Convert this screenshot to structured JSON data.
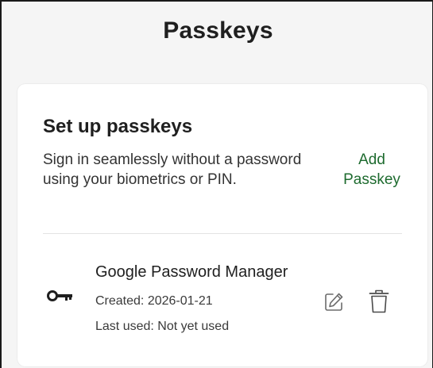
{
  "header": {
    "title": "Passkeys"
  },
  "setup": {
    "title": "Set up passkeys",
    "description": "Sign in seamlessly without a password using your biometrics or PIN.",
    "add_label": "Add Passkey"
  },
  "passkeys": [
    {
      "name": "Google Password Manager",
      "created": "Created: 2026-01-21",
      "last_used": "Last used: Not yet used",
      "icon": "key-icon"
    }
  ],
  "icons": {
    "edit": "edit-icon",
    "delete": "trash-icon"
  },
  "colors": {
    "accent": "#1e6b2f",
    "background": "#f5f5f5",
    "card": "#ffffff"
  }
}
